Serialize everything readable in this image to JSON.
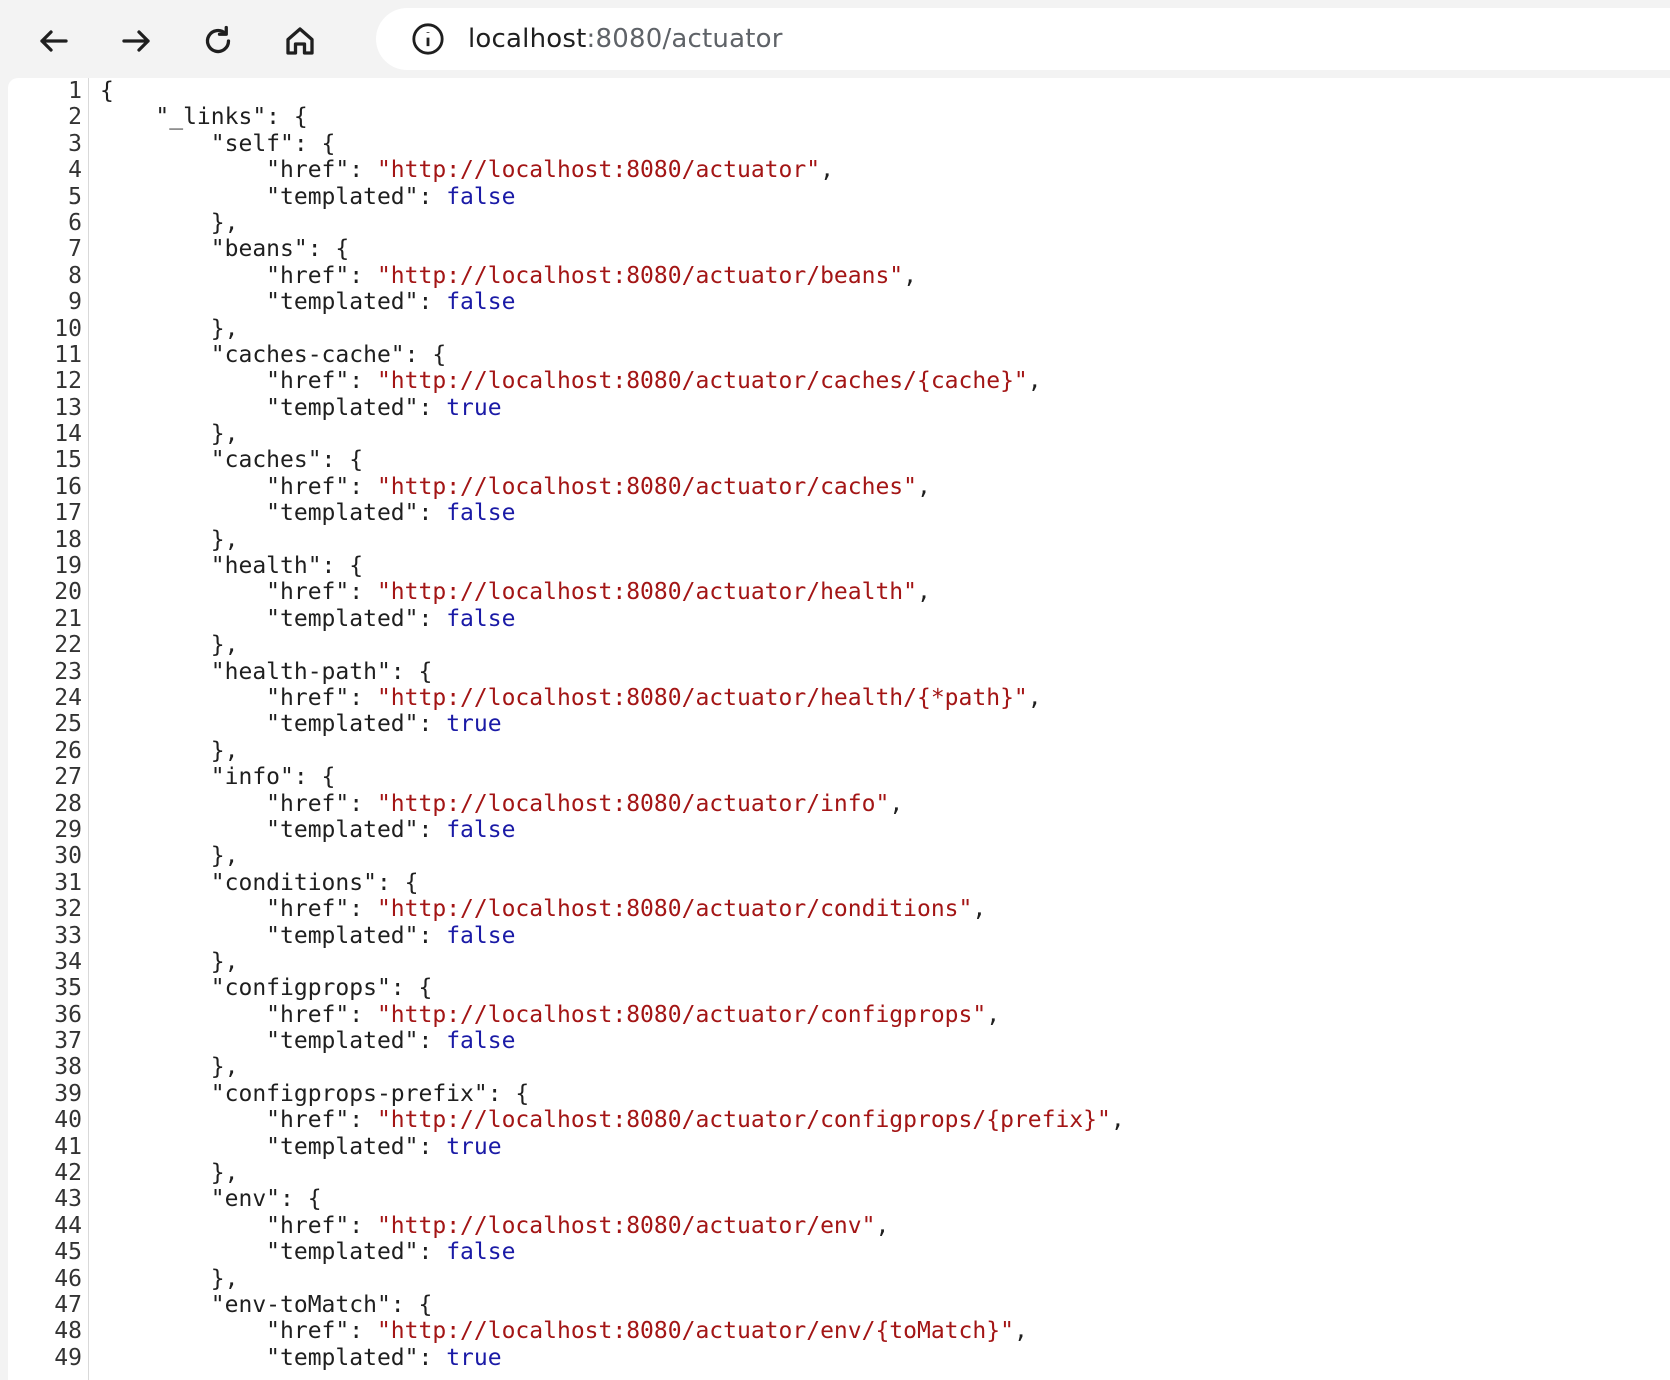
{
  "browser": {
    "url_host": "localhost",
    "url_rest": ":8080/actuator",
    "icons": [
      "back-icon",
      "forward-icon",
      "reload-icon",
      "home-icon",
      "info-icon"
    ]
  },
  "colors": {
    "string": "#a31515",
    "boolean": "#1a1aa6",
    "text": "#1f1f1f"
  },
  "json_lines": [
    {
      "n": "1",
      "indent": "",
      "parts": [
        [
          "p",
          "{"
        ]
      ]
    },
    {
      "n": "2",
      "indent": "    ",
      "parts": [
        [
          "p",
          "\"_links\": {"
        ]
      ]
    },
    {
      "n": "3",
      "indent": "        ",
      "parts": [
        [
          "p",
          "\"self\": {"
        ]
      ]
    },
    {
      "n": "4",
      "indent": "            ",
      "parts": [
        [
          "p",
          "\"href\": "
        ],
        [
          "s",
          "\"http://localhost:8080/actuator\""
        ],
        [
          "p",
          ","
        ]
      ]
    },
    {
      "n": "5",
      "indent": "            ",
      "parts": [
        [
          "p",
          "\"templated\": "
        ],
        [
          "b",
          "false"
        ]
      ]
    },
    {
      "n": "6",
      "indent": "        ",
      "parts": [
        [
          "p",
          "},"
        ]
      ]
    },
    {
      "n": "7",
      "indent": "        ",
      "parts": [
        [
          "p",
          "\"beans\": {"
        ]
      ]
    },
    {
      "n": "8",
      "indent": "            ",
      "parts": [
        [
          "p",
          "\"href\": "
        ],
        [
          "s",
          "\"http://localhost:8080/actuator/beans\""
        ],
        [
          "p",
          ","
        ]
      ]
    },
    {
      "n": "9",
      "indent": "            ",
      "parts": [
        [
          "p",
          "\"templated\": "
        ],
        [
          "b",
          "false"
        ]
      ]
    },
    {
      "n": "10",
      "indent": "        ",
      "parts": [
        [
          "p",
          "},"
        ]
      ]
    },
    {
      "n": "11",
      "indent": "        ",
      "parts": [
        [
          "p",
          "\"caches-cache\": {"
        ]
      ]
    },
    {
      "n": "12",
      "indent": "            ",
      "parts": [
        [
          "p",
          "\"href\": "
        ],
        [
          "s",
          "\"http://localhost:8080/actuator/caches/{cache}\""
        ],
        [
          "p",
          ","
        ]
      ]
    },
    {
      "n": "13",
      "indent": "            ",
      "parts": [
        [
          "p",
          "\"templated\": "
        ],
        [
          "b",
          "true"
        ]
      ]
    },
    {
      "n": "14",
      "indent": "        ",
      "parts": [
        [
          "p",
          "},"
        ]
      ]
    },
    {
      "n": "15",
      "indent": "        ",
      "parts": [
        [
          "p",
          "\"caches\": {"
        ]
      ]
    },
    {
      "n": "16",
      "indent": "            ",
      "parts": [
        [
          "p",
          "\"href\": "
        ],
        [
          "s",
          "\"http://localhost:8080/actuator/caches\""
        ],
        [
          "p",
          ","
        ]
      ]
    },
    {
      "n": "17",
      "indent": "            ",
      "parts": [
        [
          "p",
          "\"templated\": "
        ],
        [
          "b",
          "false"
        ]
      ]
    },
    {
      "n": "18",
      "indent": "        ",
      "parts": [
        [
          "p",
          "},"
        ]
      ]
    },
    {
      "n": "19",
      "indent": "        ",
      "parts": [
        [
          "p",
          "\"health\": {"
        ]
      ]
    },
    {
      "n": "20",
      "indent": "            ",
      "parts": [
        [
          "p",
          "\"href\": "
        ],
        [
          "s",
          "\"http://localhost:8080/actuator/health\""
        ],
        [
          "p",
          ","
        ]
      ]
    },
    {
      "n": "21",
      "indent": "            ",
      "parts": [
        [
          "p",
          "\"templated\": "
        ],
        [
          "b",
          "false"
        ]
      ]
    },
    {
      "n": "22",
      "indent": "        ",
      "parts": [
        [
          "p",
          "},"
        ]
      ]
    },
    {
      "n": "23",
      "indent": "        ",
      "parts": [
        [
          "p",
          "\"health-path\": {"
        ]
      ]
    },
    {
      "n": "24",
      "indent": "            ",
      "parts": [
        [
          "p",
          "\"href\": "
        ],
        [
          "s",
          "\"http://localhost:8080/actuator/health/{*path}\""
        ],
        [
          "p",
          ","
        ]
      ]
    },
    {
      "n": "25",
      "indent": "            ",
      "parts": [
        [
          "p",
          "\"templated\": "
        ],
        [
          "b",
          "true"
        ]
      ]
    },
    {
      "n": "26",
      "indent": "        ",
      "parts": [
        [
          "p",
          "},"
        ]
      ]
    },
    {
      "n": "27",
      "indent": "        ",
      "parts": [
        [
          "p",
          "\"info\": {"
        ]
      ]
    },
    {
      "n": "28",
      "indent": "            ",
      "parts": [
        [
          "p",
          "\"href\": "
        ],
        [
          "s",
          "\"http://localhost:8080/actuator/info\""
        ],
        [
          "p",
          ","
        ]
      ]
    },
    {
      "n": "29",
      "indent": "            ",
      "parts": [
        [
          "p",
          "\"templated\": "
        ],
        [
          "b",
          "false"
        ]
      ]
    },
    {
      "n": "30",
      "indent": "        ",
      "parts": [
        [
          "p",
          "},"
        ]
      ]
    },
    {
      "n": "31",
      "indent": "        ",
      "parts": [
        [
          "p",
          "\"conditions\": {"
        ]
      ]
    },
    {
      "n": "32",
      "indent": "            ",
      "parts": [
        [
          "p",
          "\"href\": "
        ],
        [
          "s",
          "\"http://localhost:8080/actuator/conditions\""
        ],
        [
          "p",
          ","
        ]
      ]
    },
    {
      "n": "33",
      "indent": "            ",
      "parts": [
        [
          "p",
          "\"templated\": "
        ],
        [
          "b",
          "false"
        ]
      ]
    },
    {
      "n": "34",
      "indent": "        ",
      "parts": [
        [
          "p",
          "},"
        ]
      ]
    },
    {
      "n": "35",
      "indent": "        ",
      "parts": [
        [
          "p",
          "\"configprops\": {"
        ]
      ]
    },
    {
      "n": "36",
      "indent": "            ",
      "parts": [
        [
          "p",
          "\"href\": "
        ],
        [
          "s",
          "\"http://localhost:8080/actuator/configprops\""
        ],
        [
          "p",
          ","
        ]
      ]
    },
    {
      "n": "37",
      "indent": "            ",
      "parts": [
        [
          "p",
          "\"templated\": "
        ],
        [
          "b",
          "false"
        ]
      ]
    },
    {
      "n": "38",
      "indent": "        ",
      "parts": [
        [
          "p",
          "},"
        ]
      ]
    },
    {
      "n": "39",
      "indent": "        ",
      "parts": [
        [
          "p",
          "\"configprops-prefix\": {"
        ]
      ]
    },
    {
      "n": "40",
      "indent": "            ",
      "parts": [
        [
          "p",
          "\"href\": "
        ],
        [
          "s",
          "\"http://localhost:8080/actuator/configprops/{prefix}\""
        ],
        [
          "p",
          ","
        ]
      ]
    },
    {
      "n": "41",
      "indent": "            ",
      "parts": [
        [
          "p",
          "\"templated\": "
        ],
        [
          "b",
          "true"
        ]
      ]
    },
    {
      "n": "42",
      "indent": "        ",
      "parts": [
        [
          "p",
          "},"
        ]
      ]
    },
    {
      "n": "43",
      "indent": "        ",
      "parts": [
        [
          "p",
          "\"env\": {"
        ]
      ]
    },
    {
      "n": "44",
      "indent": "            ",
      "parts": [
        [
          "p",
          "\"href\": "
        ],
        [
          "s",
          "\"http://localhost:8080/actuator/env\""
        ],
        [
          "p",
          ","
        ]
      ]
    },
    {
      "n": "45",
      "indent": "            ",
      "parts": [
        [
          "p",
          "\"templated\": "
        ],
        [
          "b",
          "false"
        ]
      ]
    },
    {
      "n": "46",
      "indent": "        ",
      "parts": [
        [
          "p",
          "},"
        ]
      ]
    },
    {
      "n": "47",
      "indent": "        ",
      "parts": [
        [
          "p",
          "\"env-toMatch\": {"
        ]
      ]
    },
    {
      "n": "48",
      "indent": "            ",
      "parts": [
        [
          "p",
          "\"href\": "
        ],
        [
          "s",
          "\"http://localhost:8080/actuator/env/{toMatch}\""
        ],
        [
          "p",
          ","
        ]
      ]
    },
    {
      "n": "49",
      "indent": "            ",
      "parts": [
        [
          "p",
          "\"templated\": "
        ],
        [
          "b",
          "true"
        ]
      ]
    }
  ]
}
